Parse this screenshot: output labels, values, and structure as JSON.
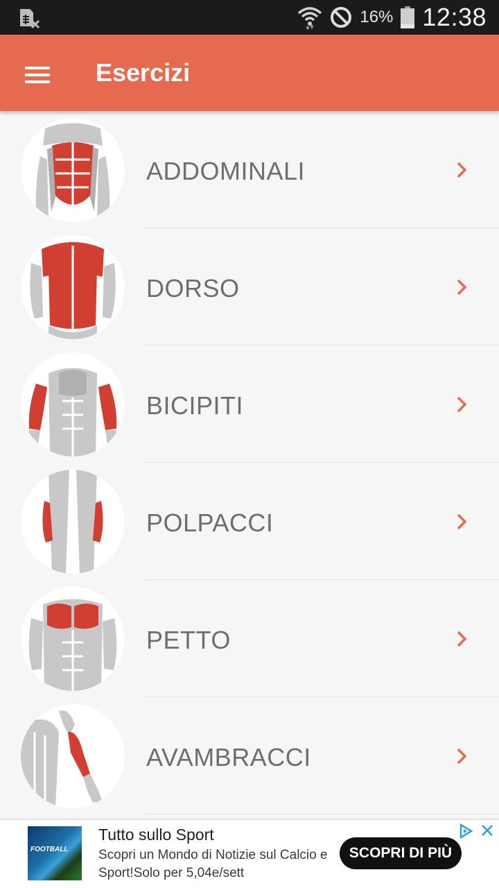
{
  "status_bar": {
    "battery_pct": "16%",
    "time": "12:38",
    "icons": [
      "sim-card-blocked-icon",
      "wifi-icon",
      "do-not-disturb-icon",
      "battery-icon"
    ]
  },
  "app_bar": {
    "title": "Esercizi",
    "menu_icon": "hamburger-menu-icon"
  },
  "exercises": [
    {
      "label": "ADDOMINALI",
      "image": "abs-muscles"
    },
    {
      "label": "DORSO",
      "image": "back-muscles"
    },
    {
      "label": "BICIPITI",
      "image": "biceps-muscles"
    },
    {
      "label": "POLPACCI",
      "image": "calves-muscles"
    },
    {
      "label": "PETTO",
      "image": "chest-muscles"
    },
    {
      "label": "AVAMBRACCI",
      "image": "forearm-muscles"
    }
  ],
  "ad": {
    "title": "Tutto sullo Sport",
    "body": "Scopri un Mondo di Notizie sul Calcio e Sport!Solo per 5,04e/sett",
    "cta": "SCOPRI DI PIÙ",
    "image_text": "FOOTBALL"
  },
  "colors": {
    "accent": "#e56a50",
    "muscle_highlight": "#d13f33",
    "muscle_base": "#c8c8c8",
    "status_bar": "#1b1b1b"
  }
}
